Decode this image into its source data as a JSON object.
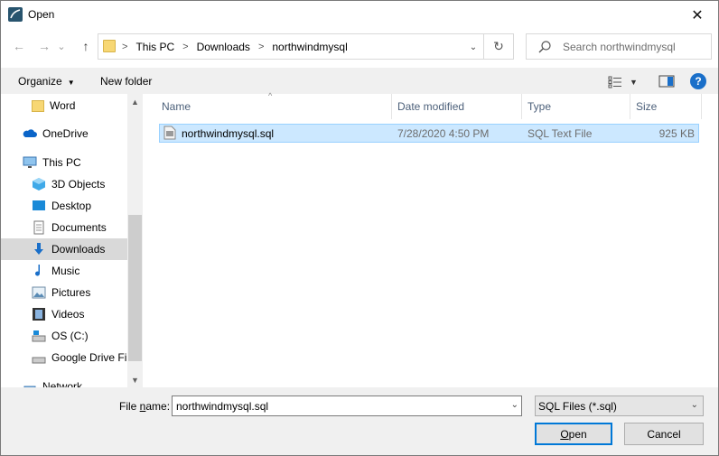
{
  "window": {
    "title": "Open",
    "close_glyph": "✕"
  },
  "address": {
    "back_glyph": "←",
    "forward_glyph": "→",
    "dropdown_glyph": "⌄",
    "up_glyph": "↑",
    "crumbs": [
      "This PC",
      "Downloads",
      "northwindmysql"
    ],
    "refresh_glyph": "↻",
    "expand_glyph": "⌄"
  },
  "search": {
    "placeholder": "Search northwindmysql"
  },
  "toolbar": {
    "organize": "Organize",
    "organize_dd": "▼",
    "new_folder": "New folder",
    "help": "?"
  },
  "nav": {
    "items": [
      {
        "label": "Word",
        "icon": "folder-icon"
      },
      {
        "label": "OneDrive",
        "icon": "cloud-icon"
      },
      {
        "label": "This PC",
        "icon": "computer-icon"
      },
      {
        "label": "3D Objects",
        "icon": "cube-icon"
      },
      {
        "label": "Desktop",
        "icon": "desktop-icon"
      },
      {
        "label": "Documents",
        "icon": "documents-icon"
      },
      {
        "label": "Downloads",
        "icon": "download-icon"
      },
      {
        "label": "Music",
        "icon": "music-icon"
      },
      {
        "label": "Pictures",
        "icon": "pictures-icon"
      },
      {
        "label": "Videos",
        "icon": "videos-icon"
      },
      {
        "label": "OS (C:)",
        "icon": "drive-icon"
      },
      {
        "label": "Google Drive File",
        "icon": "drive-icon"
      },
      {
        "label": "Network",
        "icon": "network-icon"
      }
    ],
    "selected": "Downloads",
    "scroll_up": "▲",
    "scroll_down": "▼"
  },
  "columns": {
    "name": "Name",
    "date": "Date modified",
    "type": "Type",
    "size": "Size",
    "sort_glyph": "^"
  },
  "files": [
    {
      "name": "northwindmysql.sql",
      "date": "7/28/2020 4:50 PM",
      "type": "SQL Text File",
      "size": "925 KB"
    }
  ],
  "footer": {
    "filename_label_pre": "File ",
    "filename_label_u": "n",
    "filename_label_post": "ame:",
    "filename_value": "northwindmysql.sql",
    "filename_dd": "⌄",
    "filetype_value": "SQL Files (*.sql)",
    "filetype_dd": "⌄",
    "open_u": "O",
    "open_rest": "pen",
    "cancel": "Cancel"
  },
  "colors": {
    "selection": "#cce8ff",
    "selection_border": "#99d1ff",
    "accent": "#0078d7"
  }
}
